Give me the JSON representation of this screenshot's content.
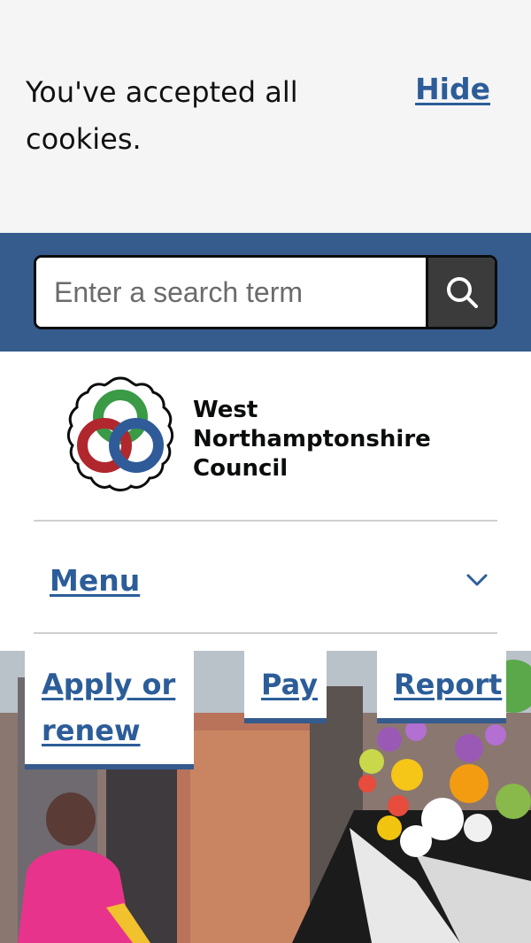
{
  "cookie_banner": {
    "message": "You've accepted all cookies.",
    "hide_label": "Hide"
  },
  "search": {
    "placeholder": "Enter a search term",
    "button_icon": "search-icon"
  },
  "header": {
    "logo_line1": "West",
    "logo_line2": "Northamptonshire",
    "logo_line3": "Council"
  },
  "menu": {
    "label": "Menu",
    "icon": "chevron-down-icon"
  },
  "quick_links": {
    "apply_label": "Apply or renew",
    "pay_label": "Pay",
    "report_label": "Report"
  },
  "colors": {
    "brand_blue": "#365b8d",
    "link_blue": "#2c5d99",
    "cookie_bg": "#f5f5f5"
  }
}
